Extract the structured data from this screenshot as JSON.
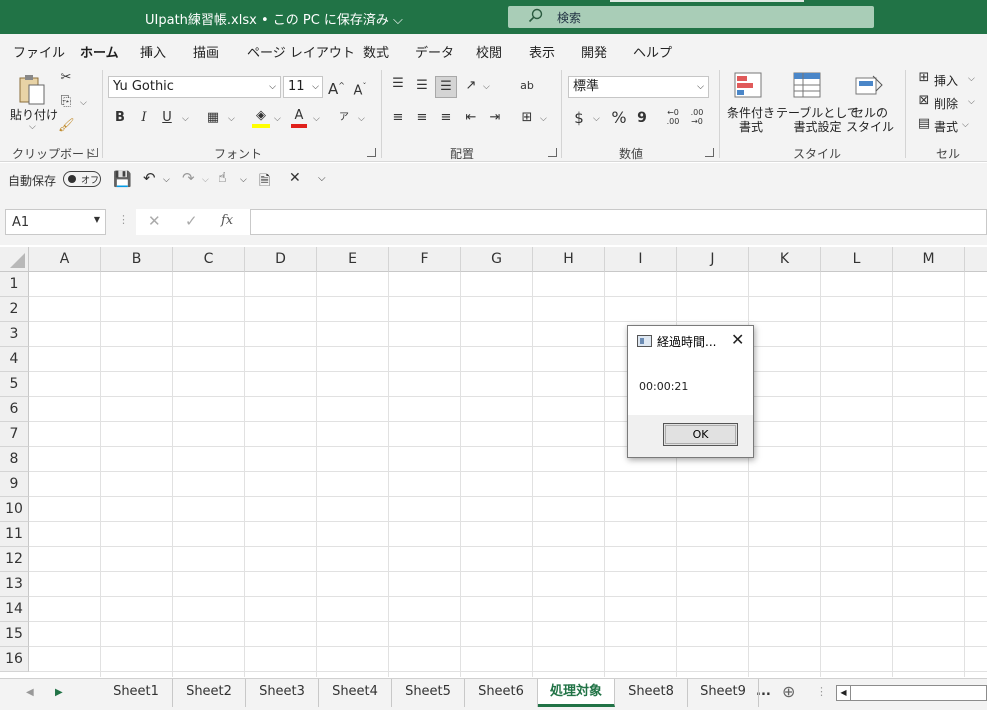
{
  "titlebar": {
    "title": "UIpath練習帳.xlsx • この PC に保存済み",
    "search_placeholder": "検索"
  },
  "ribbon_tabs": [
    "ファイル",
    "ホーム",
    "挿入",
    "描画",
    "ページ レイアウト",
    "数式",
    "データ",
    "校閲",
    "表示",
    "開発",
    "ヘルプ"
  ],
  "active_tab": "ホーム",
  "ribbon": {
    "clipboard": {
      "paste_label": "貼り付け",
      "group": "クリップボード"
    },
    "font": {
      "name": "Yu Gothic",
      "size": "11",
      "bold": "B",
      "italic": "I",
      "underline": "U",
      "group": "フォント",
      "font_color": "#e0201b",
      "highlight_color": "#ffff00"
    },
    "alignment": {
      "group": "配置"
    },
    "number": {
      "format": "標準",
      "currency": "$",
      "percent": "%",
      "comma": "9",
      "group": "数値"
    },
    "styles": {
      "conditional": "条件付き\n書式",
      "table": "テーブルとして\n書式設定",
      "cell_style": "セルの\nスタイル",
      "group": "スタイル"
    },
    "cells": {
      "insert": "挿入",
      "delete": "削除",
      "format": "書式",
      "group": "セル"
    }
  },
  "qat": {
    "autosave_label": "自動保存",
    "autosave_state": "オフ"
  },
  "formula_bar": {
    "name_box": "A1",
    "fx": "fx",
    "value": ""
  },
  "grid": {
    "columns": [
      "A",
      "B",
      "C",
      "D",
      "E",
      "F",
      "G",
      "H",
      "I",
      "J",
      "K",
      "L",
      "M"
    ],
    "rows": [
      "1",
      "2",
      "3",
      "4",
      "5",
      "6",
      "7",
      "8",
      "9",
      "10",
      "11",
      "12",
      "13",
      "14",
      "15",
      "16"
    ]
  },
  "sheets": [
    "Sheet1",
    "Sheet2",
    "Sheet3",
    "Sheet4",
    "Sheet5",
    "Sheet6",
    "処理対象",
    "Sheet8",
    "Sheet9"
  ],
  "active_sheet": "処理対象",
  "sheet_overflow": "...",
  "dialog": {
    "title": "経過時間...",
    "message": "00:00:21",
    "ok_label": "OK"
  },
  "colors": {
    "accent": "#217346"
  }
}
